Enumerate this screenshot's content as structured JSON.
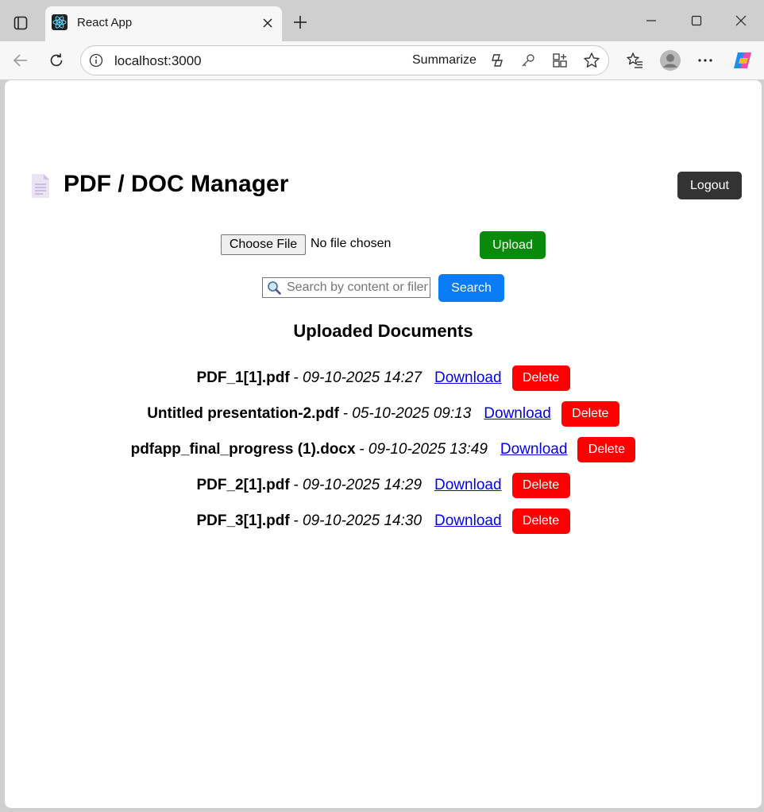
{
  "browser": {
    "tab_title": "React App",
    "address_url": "localhost:3000",
    "summarize_label": "Summarize"
  },
  "header": {
    "title": "PDF / DOC Manager",
    "logout_label": "Logout"
  },
  "upload": {
    "choose_label": "Choose File",
    "no_file_text": "No file chosen",
    "upload_label": "Upload"
  },
  "search": {
    "placeholder": "Search by content or filename",
    "button_label": "Search"
  },
  "documents": {
    "heading": "Uploaded Documents",
    "separator": "-",
    "items": [
      {
        "name": "PDF_1[1].pdf",
        "date": "09-10-2025 14:27",
        "download_label": "Download",
        "delete_label": "Delete"
      },
      {
        "name": "Untitled presentation-2.pdf",
        "date": "05-10-2025 09:13",
        "download_label": "Download",
        "delete_label": "Delete"
      },
      {
        "name": "pdfapp_final_progress (1).docx",
        "date": "09-10-2025 13:49",
        "download_label": "Download",
        "delete_label": "Delete"
      },
      {
        "name": "PDF_2[1].pdf",
        "date": "09-10-2025 14:29",
        "download_label": "Download",
        "delete_label": "Delete"
      },
      {
        "name": "PDF_3[1].pdf",
        "date": "09-10-2025 14:30",
        "download_label": "Download",
        "delete_label": "Delete"
      }
    ]
  },
  "colors": {
    "upload": "#0a8a0a",
    "search": "#0a7cf5",
    "delete": "#ff0000",
    "logout": "#333333",
    "link": "#0000ee"
  },
  "icons": [
    "tab-actions-icon",
    "react-icon",
    "close-icon",
    "plus-icon",
    "minimize-icon",
    "maximize-icon",
    "back-arrow-icon",
    "reload-icon",
    "info-icon",
    "copilot-summarize-icon",
    "key-icon",
    "add-to-apps-icon",
    "star-icon",
    "favorites-icon",
    "profile-icon",
    "more-icon",
    "copilot-icon",
    "document-icon",
    "magnifier-icon"
  ]
}
